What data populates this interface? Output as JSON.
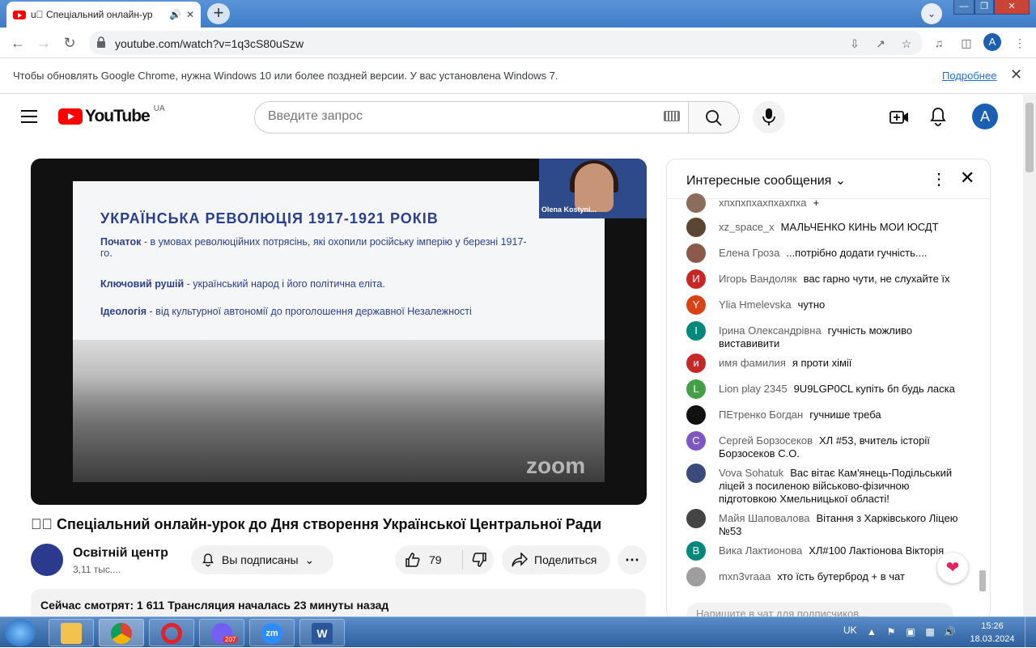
{
  "browser": {
    "tab_title": "u\u0000 Спеціальний онлайн-ур",
    "url": "youtube.com/watch?v=1q3cS80uSzw",
    "profile_letter": "A",
    "infobar_message": "Чтобы обновлять Google Chrome, нужна Windows 10 или более поздней версии. У вас установлена Windows 7.",
    "infobar_link": "Подробнее"
  },
  "youtube": {
    "logo_text": "YouTube",
    "country_code": "UA",
    "search_placeholder": "Введите запрос",
    "avatar_letter": "A"
  },
  "video": {
    "slide_title": "УКРАЇНСЬКА РЕВОЛЮЦІЯ 1917-1921 РОКІВ",
    "slide_lines": [
      {
        "label": "Початок",
        "text": " - в умовах революційних потрясінь, які охопили російську імперію у березні 1917-го."
      },
      {
        "label": "Ключовий рушій",
        "text": " - український народ і його політична еліта."
      },
      {
        "label": "Ідеологія",
        "text": " - від культурної автономії до проголошення державної Незалежності"
      }
    ],
    "camera_name": "Olena Kostyni...",
    "watermark": "zoom",
    "title": "\u0000\u0000 Спеціальний онлайн-урок до Дня створення Української Центральної Ради",
    "channel_name": "Освітній центр В",
    "channel_subs": "3,11 тыс....",
    "subscribe_label": "Вы подписаны",
    "like_count": "79",
    "share_label": "Поделиться",
    "description": "Сейчас смотрят: 1 611  Трансляция началась 23 минуты назад"
  },
  "chat": {
    "header": "Интересные сообщения",
    "input_placeholder": "Напишите в чат для подписчиков...",
    "messages": [
      {
        "author": "хпхпхпхахпхахпха",
        "text": "+",
        "avatar": "",
        "color": "#8a6d5a"
      },
      {
        "author": "xz_space_x",
        "text": "МАЛЬЧЕНКО КИНЬ МОИ ЮСДТ",
        "avatar": "",
        "color": "#5a4632"
      },
      {
        "author": "Елена Гроза",
        "text": "...потрібно додати гучність....",
        "avatar": "",
        "color": "#8b5a4a"
      },
      {
        "author": "Игорь Вандоляк",
        "text": "вас гарно чути, не слухайте їх",
        "avatar": "И",
        "color": "#c62828"
      },
      {
        "author": "Ylia Hmelevska",
        "text": "чутно",
        "avatar": "Y",
        "color": "#d84315"
      },
      {
        "author": "Ірина Олександрівна",
        "text": "гучність можливо виставивити",
        "avatar": "I",
        "color": "#00897b"
      },
      {
        "author": "имя фамилия",
        "text": "я проти хімії",
        "avatar": "и",
        "color": "#c62828"
      },
      {
        "author": "Lion play 2345",
        "text": "9U9LGP0CL купіть бп будь ласка",
        "avatar": "L",
        "color": "#43a047"
      },
      {
        "author": "ПЕтренко Богдан",
        "text": "гучнише треба",
        "avatar": "",
        "color": "#111111"
      },
      {
        "author": "Сергей Борзосеков",
        "text": "ХЛ #53, вчитель історії Борзосеков С.О.",
        "avatar": "C",
        "color": "#7e57c2"
      },
      {
        "author": "Vova Sohatuk",
        "text": "Вас вітає Кам'янець-Подільський ліцей з посиленою військово-фізичною підготовкою Хмельницької області!",
        "avatar": "",
        "color": "#3b4a7a"
      },
      {
        "author": "Майя Шаповалова",
        "text": "Вітання з Харківського Ліцею №53",
        "avatar": "",
        "color": "#444444"
      },
      {
        "author": "Вика Лактионова",
        "text": "ХЛ#100 Лактіонова Вікторія",
        "avatar": "B",
        "color": "#00897b"
      },
      {
        "author": "mxn3vraaa",
        "text": "хто їсть бутерброд + в чат",
        "avatar": "",
        "color": "#9e9e9e"
      }
    ]
  },
  "taskbar": {
    "viber_badge": "207",
    "zoom_label": "zm",
    "word_label": "W",
    "language": "UK",
    "time": "15:26",
    "date": "18.03.2024"
  }
}
